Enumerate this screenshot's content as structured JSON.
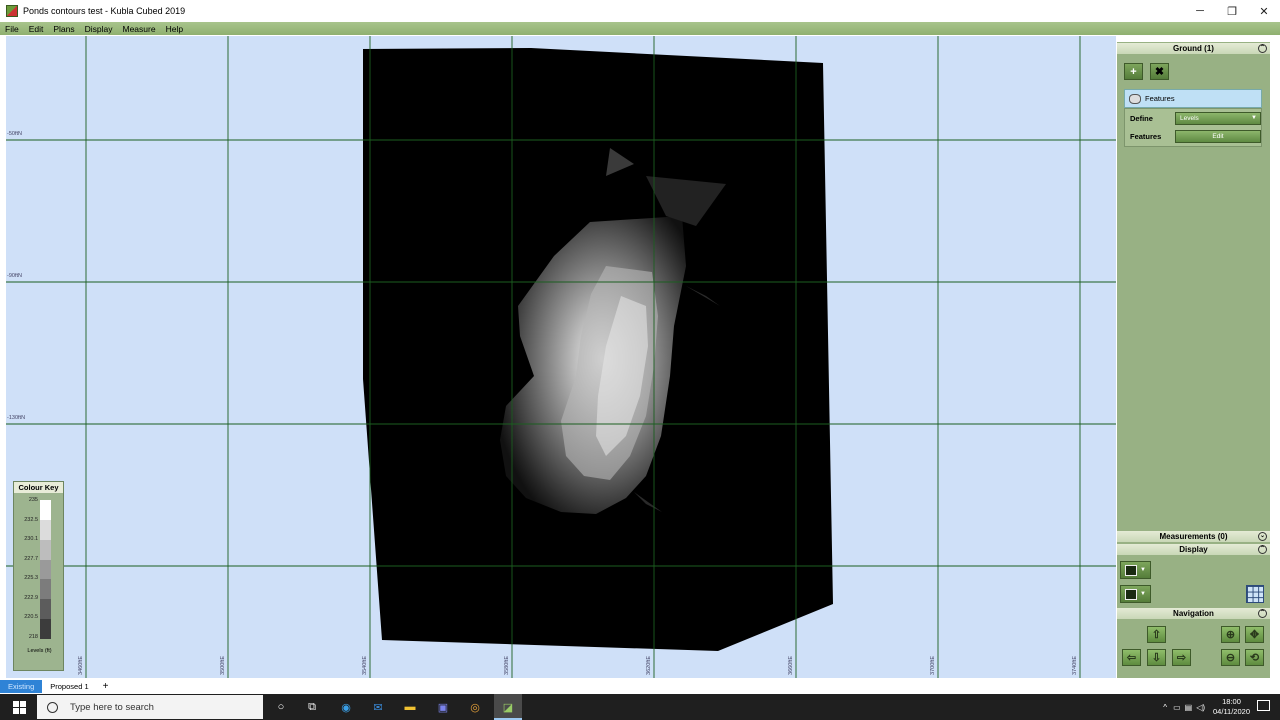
{
  "window": {
    "title": "Ponds contours test - Kubla Cubed 2019",
    "minimize": "─",
    "restore": "❐",
    "close": "✕"
  },
  "menu": [
    "File",
    "Edit",
    "Plans",
    "Display",
    "Measure",
    "Help"
  ],
  "grid_labels": {
    "northings": [
      "-50ftN",
      "-90ftN",
      "-130ftN"
    ],
    "eastings": [
      "3460ftE",
      "3500ftE",
      "3540ftE",
      "3580ftE",
      "3620ftE",
      "3660ftE",
      "3700ftE",
      "3740ftE"
    ]
  },
  "colour_key": {
    "title": "Colour Key",
    "levels": [
      "235",
      "232.5",
      "230.1",
      "227.7",
      "225.3",
      "222.9",
      "220.5",
      "218"
    ],
    "units": "Levels (ft)",
    "colors": [
      "#ffffff",
      "#dcdcdc",
      "#bdbdbd",
      "#9a9a9a",
      "#7c7c7c",
      "#5c5c5c",
      "#3c3c3c",
      "#000000"
    ]
  },
  "right_panel": {
    "ground": {
      "header": "Ground (1)",
      "add_label": "+",
      "delete_label": "✖",
      "features_item": "Features",
      "define_label": "Define",
      "define_value": "Levels",
      "features_label": "Features",
      "edit_label": "Edit"
    },
    "measurements_header": "Measurements (0)",
    "display_header": "Display",
    "navigation_header": "Navigation"
  },
  "tabs": {
    "items": [
      "Existing",
      "Proposed 1"
    ],
    "add": "+"
  },
  "taskbar": {
    "search_placeholder": "Type here to search",
    "time": "18:00",
    "date": "04/11/2020"
  }
}
